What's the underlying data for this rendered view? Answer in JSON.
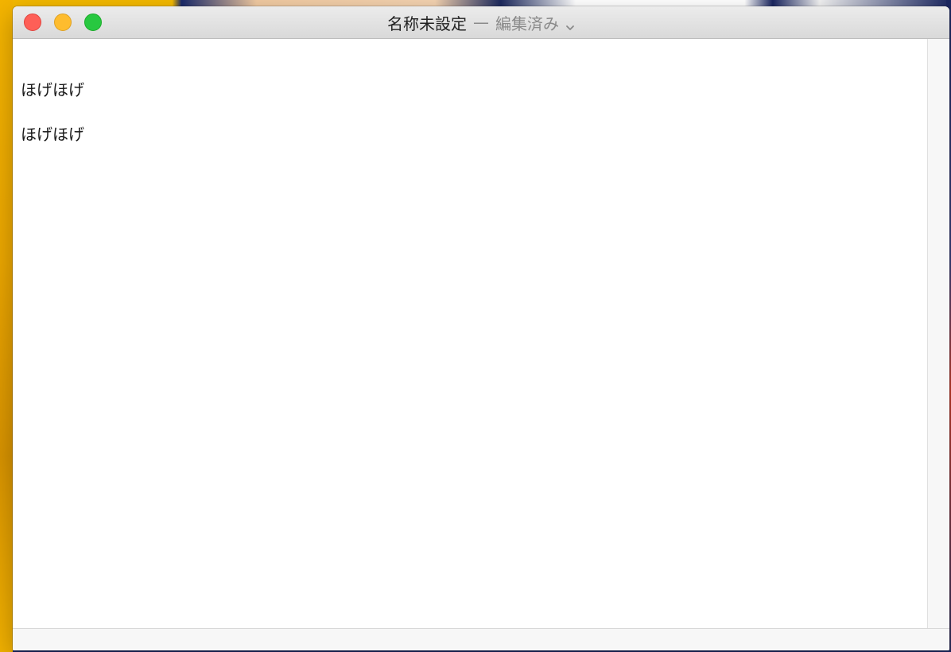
{
  "window": {
    "title": "名称未設定",
    "separator": "—",
    "status": "編集済み",
    "title_menu_icon": "chevron-down-icon"
  },
  "controls": {
    "close_icon": "close-icon",
    "minimize_icon": "minimize-icon",
    "zoom_icon": "zoom-icon",
    "colors": {
      "close": "#fe5f57",
      "minimize": "#febc2e",
      "zoom": "#28c840"
    }
  },
  "document": {
    "lines": [
      "ほげほげ",
      "ほげほげ"
    ]
  }
}
